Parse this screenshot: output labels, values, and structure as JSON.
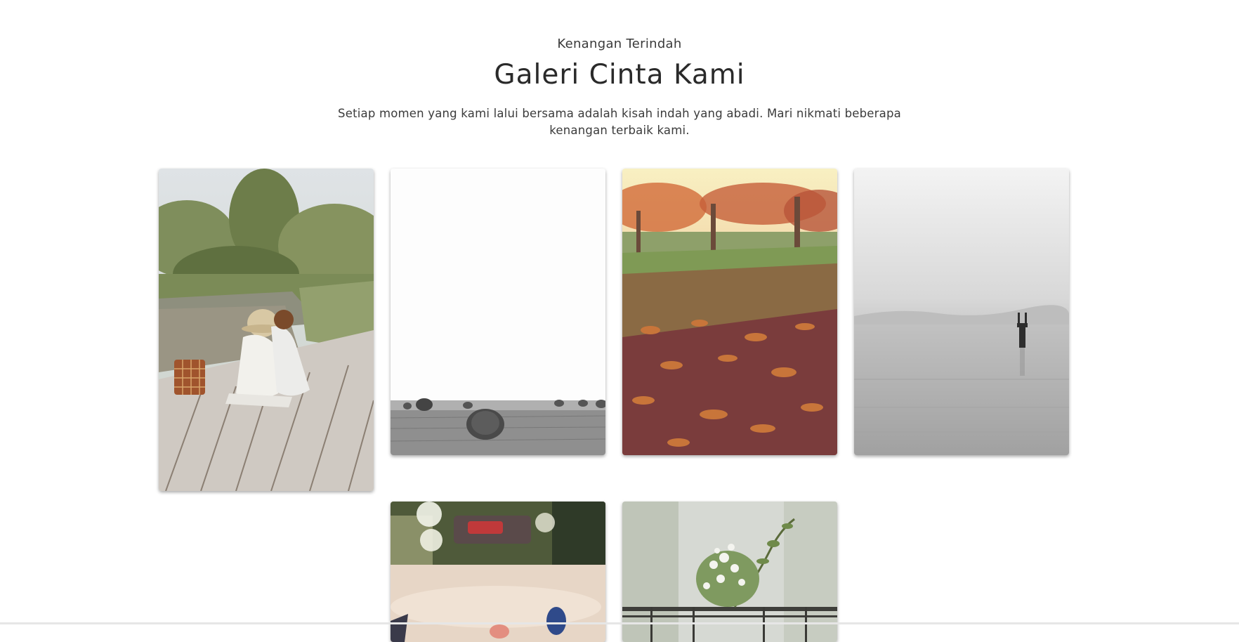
{
  "gallery": {
    "eyebrow": "Kenangan Terindah",
    "title": "Galeri Cinta Kami",
    "description": "Setiap momen yang kami lalui bersama adalah kisah indah yang abadi. Mari nikmati beberapa kenangan terbaik kami.",
    "photos": [
      {
        "name": "photo-couple-picnic"
      },
      {
        "name": "photo-hay-bales"
      },
      {
        "name": "photo-autumn-leaves"
      },
      {
        "name": "photo-misty-lake"
      },
      {
        "name": "photo-bokeh-lights"
      },
      {
        "name": "photo-flower-vase"
      }
    ]
  }
}
